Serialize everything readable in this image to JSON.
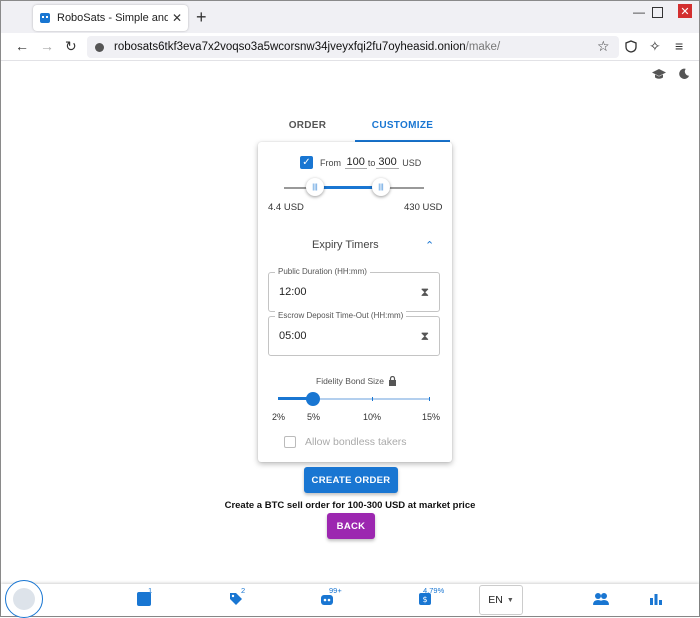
{
  "browser": {
    "tab_title": "RoboSats - Simple and Private Bitcoin",
    "tab_close": "✕",
    "new_tab": "+",
    "url_host": "robosats6tkf3eva7x2voqso3a5wcorsnw34jveyxfqi2fu7oyheasid.onion",
    "url_path": "/make/"
  },
  "tabs": {
    "order": "ORDER",
    "customize": "CUSTOMIZE"
  },
  "amount": {
    "from_label": "From",
    "min": "100",
    "to_label": "to",
    "max": "300",
    "currency": "USD",
    "range_min_label": "4.4 USD",
    "range_max_label": "430 USD"
  },
  "expiry": {
    "title": "Expiry Timers",
    "public_label": "Public Duration (HH:mm)",
    "public_value": "12:00",
    "escrow_label": "Escrow Deposit Time-Out (HH:mm)",
    "escrow_value": "05:00"
  },
  "bond": {
    "title": "Fidelity Bond Size",
    "marks": [
      "2%",
      "5%",
      "10%",
      "15%"
    ],
    "value": 5,
    "bondless_label": "Allow bondless takers"
  },
  "actions": {
    "create_label": "CREATE ORDER",
    "summary": "Create a BTC sell order for 100-300 USD at market price",
    "back_label": "BACK"
  },
  "bottombar": {
    "badge_orders": "1",
    "badge_offers": "2",
    "badge_robots": "99+",
    "badge_fee": "4.79%",
    "lang": "EN"
  },
  "colors": {
    "primary": "#1976d2",
    "secondary": "#9c27b0"
  }
}
